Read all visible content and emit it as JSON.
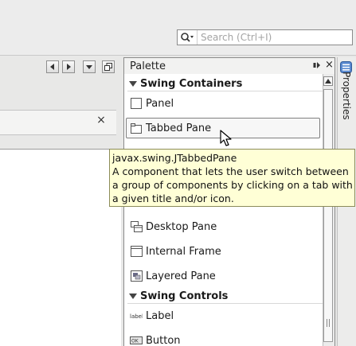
{
  "search": {
    "placeholder": "Search (Ctrl+I)"
  },
  "editor": {
    "tab_close": "×"
  },
  "palette": {
    "title": "Palette",
    "close": "×",
    "categories": [
      {
        "name": "Swing Containers",
        "items": [
          "Panel",
          "Tabbed Pane",
          "Desktop Pane",
          "Internal Frame",
          "Layered Pane"
        ]
      },
      {
        "name": "Swing Controls",
        "items": [
          "Label",
          "Button"
        ]
      }
    ]
  },
  "properties": {
    "label": "Properties"
  },
  "tooltip": {
    "line1": "javax.swing.JTabbedPane",
    "line2": "A component that lets the user switch between",
    "line3": "a group of components by clicking on a tab with",
    "line4": "a given title and/or icon."
  },
  "colors": {
    "tooltip_bg": "#ffffd6",
    "panel_bg": "#f2f2f1"
  }
}
